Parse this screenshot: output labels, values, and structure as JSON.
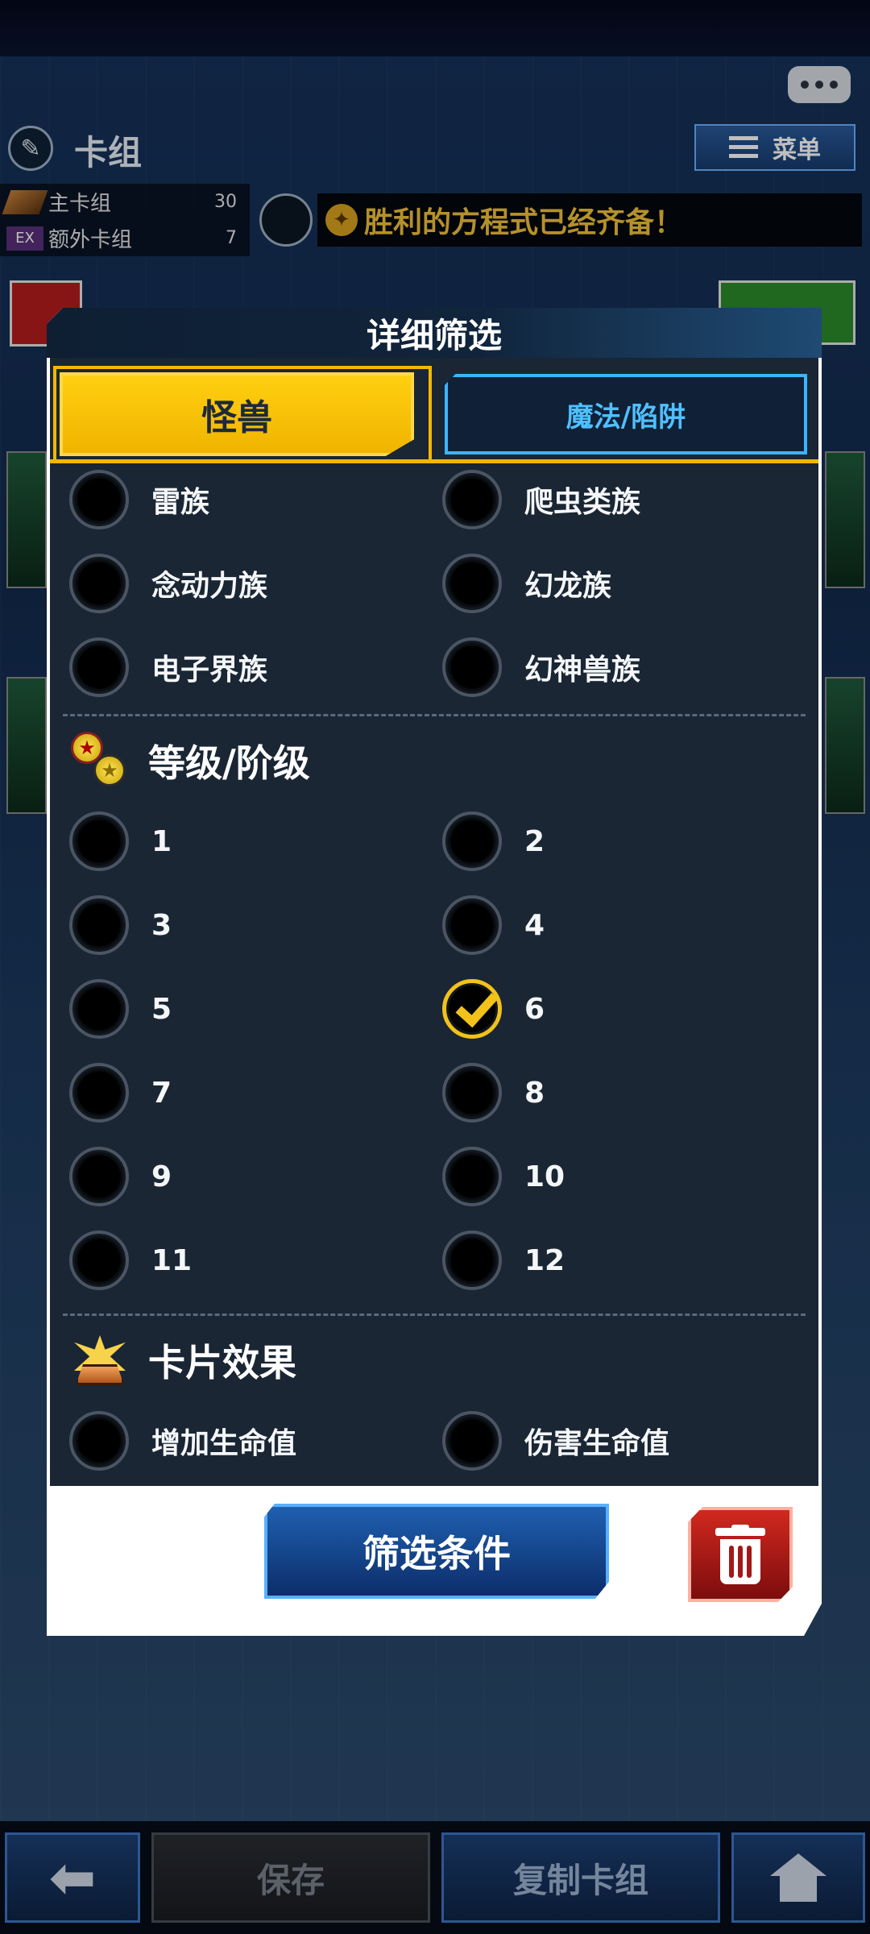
{
  "screen": {
    "header_title": "卡组",
    "menu_label": "菜单",
    "main_deck_label": "主卡组",
    "main_deck_count": "30",
    "extra_deck_badge": "EX",
    "extra_deck_label": "额外卡组",
    "extra_deck_count": "7",
    "message": "胜利的方程式已经齐备！"
  },
  "modal": {
    "title": "详细筛选",
    "tabs": [
      {
        "label": "怪兽",
        "active": true
      },
      {
        "label": "魔法/陷阱",
        "active": false
      }
    ],
    "type_options": [
      {
        "label": "雷族",
        "checked": false
      },
      {
        "label": "爬虫类族",
        "checked": false
      },
      {
        "label": "念动力族",
        "checked": false
      },
      {
        "label": "幻龙族",
        "checked": false
      },
      {
        "label": "电子界族",
        "checked": false
      },
      {
        "label": "幻神兽族",
        "checked": false
      }
    ],
    "level_section": {
      "title": "等级/阶级",
      "options": [
        {
          "label": "1",
          "checked": false
        },
        {
          "label": "2",
          "checked": false
        },
        {
          "label": "3",
          "checked": false
        },
        {
          "label": "4",
          "checked": false
        },
        {
          "label": "5",
          "checked": false
        },
        {
          "label": "6",
          "checked": true
        },
        {
          "label": "7",
          "checked": false
        },
        {
          "label": "8",
          "checked": false
        },
        {
          "label": "9",
          "checked": false
        },
        {
          "label": "10",
          "checked": false
        },
        {
          "label": "11",
          "checked": false
        },
        {
          "label": "12",
          "checked": false
        }
      ]
    },
    "effect_section": {
      "title": "卡片效果",
      "options": [
        {
          "label": "增加生命值",
          "checked": false
        },
        {
          "label": "伤害生命值",
          "checked": false
        }
      ]
    },
    "filter_button": "筛选条件"
  },
  "bottom_bar": {
    "save": "保存",
    "copy_deck": "复制卡组"
  },
  "colors": {
    "accent_yellow": "#f2c21a",
    "accent_blue": "#38b6ff",
    "panel": "#1a2634",
    "danger_red": "#b61c1c"
  }
}
